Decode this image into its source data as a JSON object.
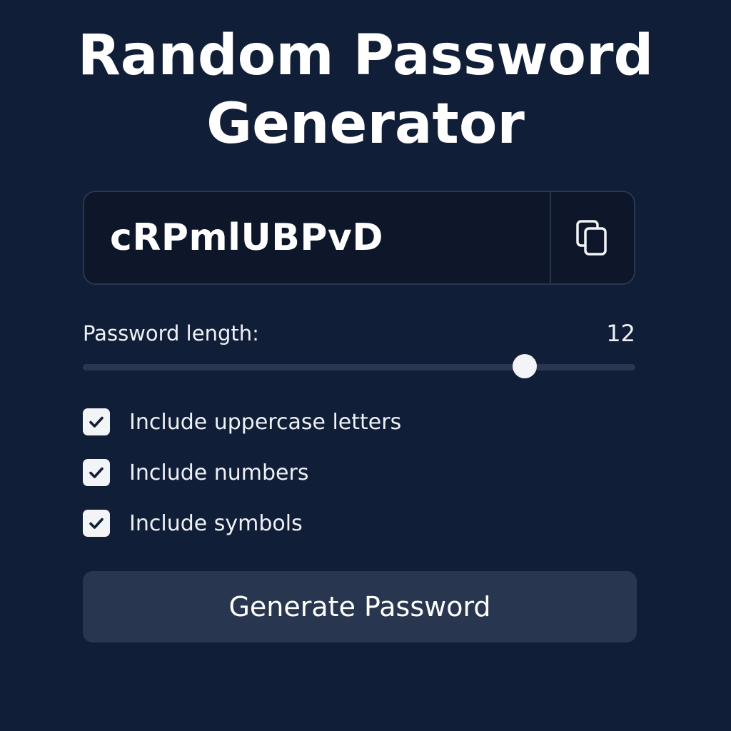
{
  "app": {
    "title_line1": "Random Password",
    "title_line2": "Generator"
  },
  "password": {
    "value": "cRPmlUBPvD",
    "copy_icon": "copy-icon"
  },
  "length": {
    "label": "Password length:",
    "value": "12",
    "slider_fraction": 0.8
  },
  "options": [
    {
      "label": "Include uppercase letters",
      "checked": true
    },
    {
      "label": "Include numbers",
      "checked": true
    },
    {
      "label": "Include symbols",
      "checked": true
    }
  ],
  "generate": {
    "label": "Generate Password"
  },
  "colors": {
    "background": "#111e37",
    "button": "#283650",
    "field": "#0e1729",
    "text": "#ffffff"
  }
}
